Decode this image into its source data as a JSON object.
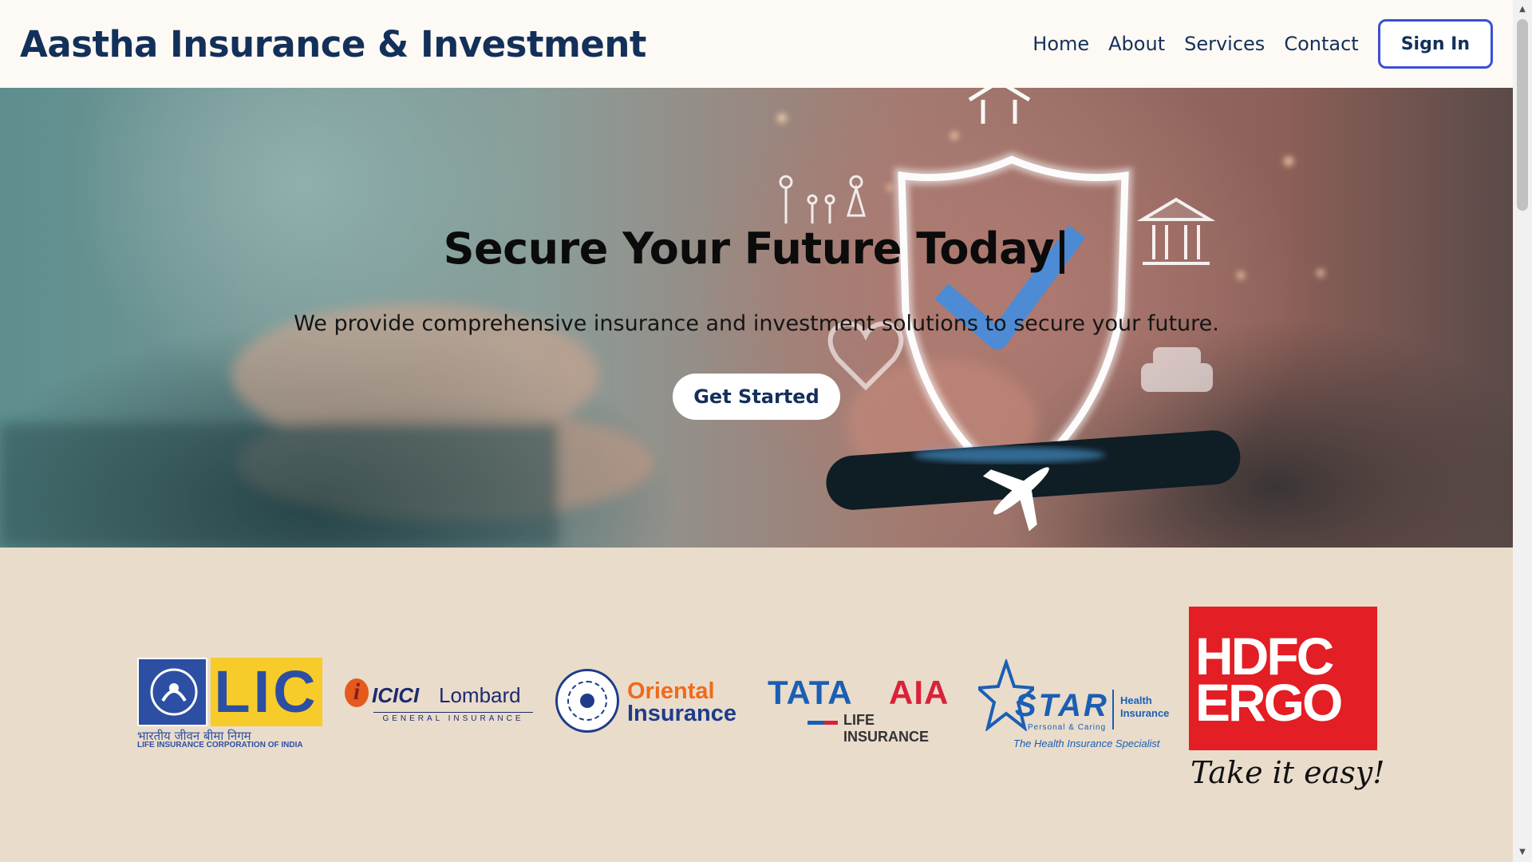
{
  "header": {
    "brand": "Aastha Insurance & Investment",
    "nav": [
      "Home",
      "About",
      "Services",
      "Contact"
    ],
    "signin_label": "Sign In"
  },
  "hero": {
    "title": "Secure Your Future Today|",
    "subtitle": "We provide comprehensive insurance and investment solutions to secure your future.",
    "cta_label": "Get Started"
  },
  "partners": {
    "lic": {
      "mark": "LIC",
      "hindi": "भारतीय जीवन बीमा निगम",
      "caption": "LIFE INSURANCE CORPORATION OF INDIA"
    },
    "icici": {
      "name1": "ICICI",
      "name2": "Lombard",
      "tagline": "GENERAL INSURANCE"
    },
    "oriental": {
      "line1": "Oriental",
      "line2": "Insurance"
    },
    "tata": {
      "line1a": "TATA",
      "line1b": "AIA",
      "line2": "LIFE INSURANCE"
    },
    "star": {
      "name": "STAR",
      "sub": "Personal & Caring",
      "health": "Health",
      "insurance": "Insurance",
      "tagline": "The Health Insurance Specialist"
    },
    "hdfc": {
      "line1": "HDFC",
      "line2": "ERGO",
      "tagline": "Take it easy!"
    }
  },
  "colors": {
    "brand": "#13305a",
    "signin_border": "#3a4fd6",
    "strip_bg": "#e9dccb",
    "lic_blue": "#2d4fa3",
    "lic_yellow": "#f7cc2a",
    "oriental_orange": "#f06a1c",
    "tata_blue": "#1a5fb4",
    "tata_red": "#d9223a",
    "hdfc_red": "#e31e24"
  }
}
